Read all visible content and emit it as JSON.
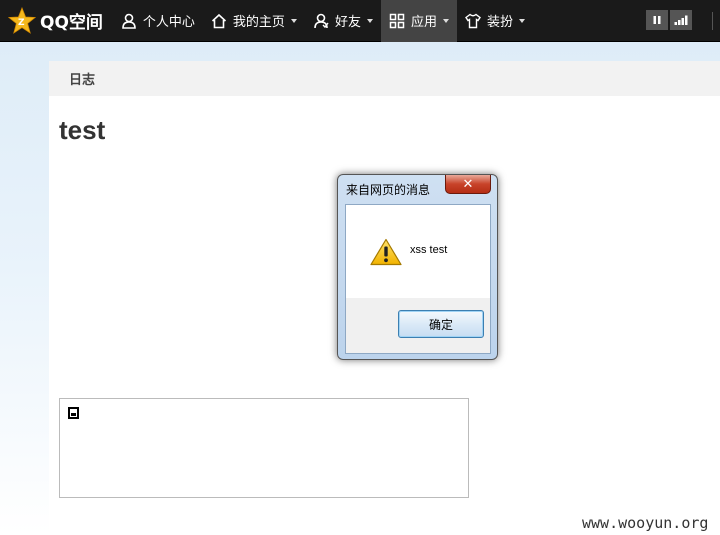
{
  "topbar": {
    "logo_text": "QQ空间",
    "nav": [
      {
        "label": "个人中心",
        "icon": "person-icon"
      },
      {
        "label": "我的主页",
        "icon": "home-icon"
      },
      {
        "label": "好友",
        "icon": "friends-icon"
      },
      {
        "label": "应用",
        "icon": "apps-grid-icon"
      },
      {
        "label": "装扮",
        "icon": "tshirt-icon"
      }
    ]
  },
  "content": {
    "section_title": "日志",
    "post_title": "test"
  },
  "dialog": {
    "title": "来自网页的消息",
    "close_glyph": "✕",
    "message": "xss test",
    "ok_label": "确定"
  },
  "watermark": "www.wooyun.org"
}
